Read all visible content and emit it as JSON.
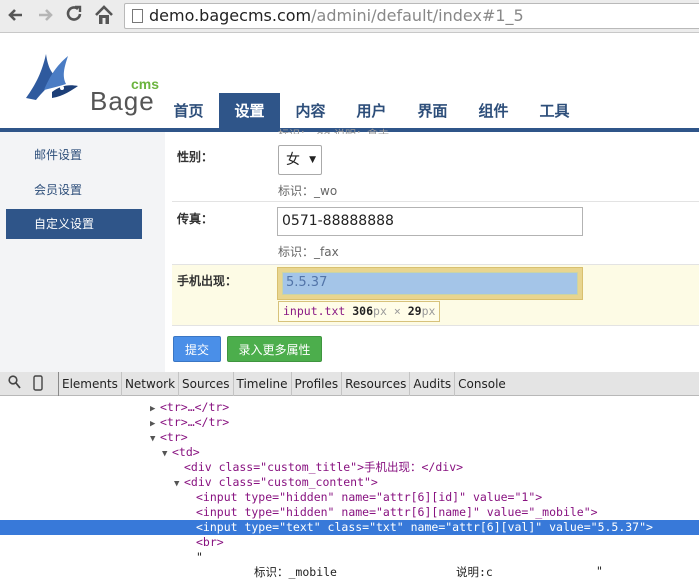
{
  "browser": {
    "url_host": "demo.bagecms.com",
    "url_path": "/admini/default/index#1_5",
    "back_icon": "arrow-left-icon",
    "forward_icon": "arrow-right-icon",
    "reload_icon": "reload-icon",
    "home_icon": "home-icon"
  },
  "logo": {
    "text": "Bage",
    "superscript": "cms"
  },
  "mainnav": [
    {
      "label": "首页",
      "active": false
    },
    {
      "label": "设置",
      "active": true
    },
    {
      "label": "内容",
      "active": false
    },
    {
      "label": "用户",
      "active": false
    },
    {
      "label": "界面",
      "active": false
    },
    {
      "label": "组件",
      "active": false
    },
    {
      "label": "工具",
      "active": false
    }
  ],
  "sidebar": {
    "items": [
      {
        "label": "邮件设置",
        "active": false
      },
      {
        "label": "会员设置",
        "active": false
      },
      {
        "label": "自定义设置",
        "active": true
      }
    ]
  },
  "form": {
    "clipped_hint": "标识：_qq  说明：拿去",
    "gender": {
      "label": "性别：",
      "selected": "女",
      "hint": "标识：_wo"
    },
    "fax": {
      "label": "传真：",
      "value": "0571-88888888",
      "hint": "标识：_fax"
    },
    "mobile": {
      "label": "手机出现：",
      "value": "5.5.37"
    },
    "inspect_tooltip": {
      "tag": "input.txt",
      "width": "306",
      "height": "29",
      "unit": "px",
      "times": "×"
    },
    "submit_label": "提交",
    "add_more_label": "录入更多属性"
  },
  "devtools": {
    "tabs": [
      "Elements",
      "Network",
      "Sources",
      "Timeline",
      "Profiles",
      "Resources",
      "Audits",
      "Console"
    ],
    "lines": [
      {
        "indent": 0,
        "text": "<tr>…</tr>"
      },
      {
        "indent": 0,
        "text": "<tr>…</tr>"
      },
      {
        "indent": 0,
        "text": "<tr>"
      },
      {
        "indent": 1,
        "text": "<td>"
      },
      {
        "indent": 2,
        "text": "<div class=\"custom_title\">手机出现：</div>"
      },
      {
        "indent": 2,
        "text": "<div class=\"custom_content\">"
      },
      {
        "indent": 3,
        "text": "<input type=\"hidden\" name=\"attr[6][id]\" value=\"1\">"
      },
      {
        "indent": 3,
        "text": "<input type=\"hidden\" name=\"attr[6][name]\" value=\"_mobile\">"
      },
      {
        "indent": 3,
        "text": "<input type=\"text\" class=\"txt\" name=\"attr[6][val]\" value=\"5.5.37\">"
      },
      {
        "indent": 3,
        "text": "<br>"
      },
      {
        "indent": 3,
        "text": "\""
      }
    ],
    "footer_left": "标识：_mobile",
    "footer_mid": "说明:c",
    "footer_right": "\""
  },
  "colors": {
    "brand_blue": "#2f5589",
    "submit_blue": "#4a8fe8",
    "add_green": "#4cae4c",
    "selection_blue": "#3879d9"
  }
}
